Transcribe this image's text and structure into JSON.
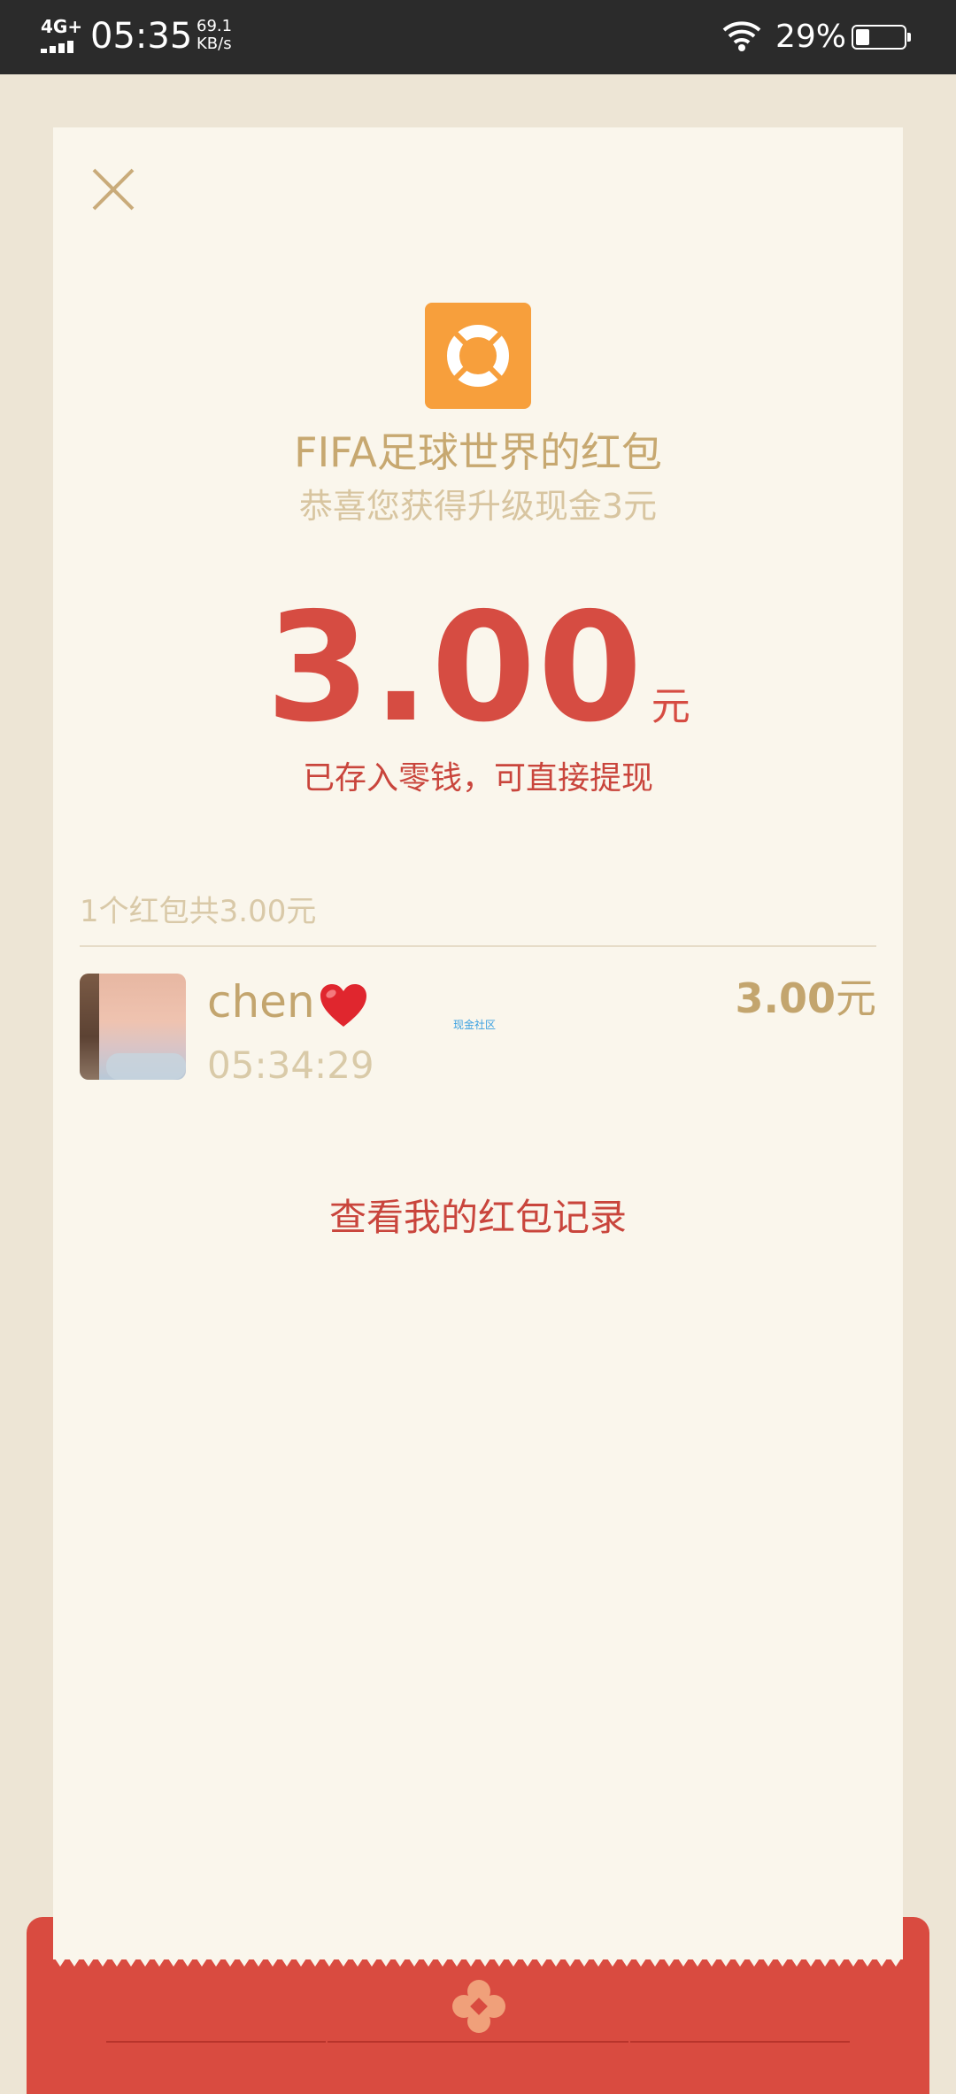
{
  "status_bar": {
    "network": "4G+",
    "time": "05:35",
    "speed_value": "69.1",
    "speed_unit": "KB/s",
    "battery_percent": "29%",
    "battery_level": 0.29
  },
  "packet": {
    "sender_title": "FIFA足球世界的红包",
    "subtitle": "恭喜您获得升级现金3元",
    "amount": "3.00",
    "amount_unit": "元",
    "note": "已存入零钱，可直接提现"
  },
  "summary": "1个红包共3.00元",
  "records": [
    {
      "name": "chen",
      "time": "05:34:29",
      "amount": "3.00",
      "amount_unit": "元"
    }
  ],
  "watermark": "现金社区",
  "view_records_label": "查看我的红包记录",
  "colors": {
    "accent_red": "#d64c42",
    "gold": "#c7a870",
    "card_bg": "#faf6ec",
    "icon_orange": "#f79f3c"
  }
}
